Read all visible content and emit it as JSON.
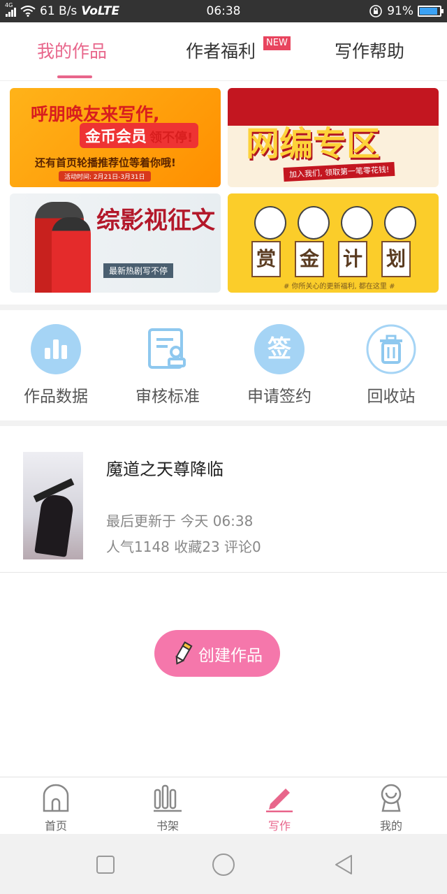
{
  "status_bar": {
    "network_type": "4G",
    "speed": "61 B/s",
    "volte": "VoLTE",
    "time": "06:38",
    "battery": "91%",
    "battery_level": 0.91,
    "battery_color": "#3ba2f5"
  },
  "tabs": [
    {
      "label": "我的作品",
      "active": true
    },
    {
      "label": "作者福利",
      "badge": "NEW"
    },
    {
      "label": "写作帮助"
    }
  ],
  "accent_color": "#e8668b",
  "banners": [
    {
      "line1": "呼朋唤友来写作,",
      "line2": "金币会员",
      "line2b": "领不停!",
      "line3": "还有首页轮播推荐位等着你哦!",
      "date": "活动时间: 2月21日-3月31日"
    },
    {
      "title": "网编专区",
      "subtitle": "加入我们, 领取第一笔零花钱!"
    },
    {
      "title": "综影视征文",
      "subtitle": "最新热剧写不停"
    },
    {
      "chars": [
        "赏",
        "金",
        "计",
        "划"
      ],
      "subtitle": "# 你所关心的更新福利, 都在这里 #"
    }
  ],
  "shortcuts": [
    {
      "label": "作品数据",
      "icon": "bar-chart-icon"
    },
    {
      "label": "审核标准",
      "icon": "document-stamp-icon"
    },
    {
      "label": "申请签约",
      "icon": "sign-icon",
      "icon_text": "签"
    },
    {
      "label": "回收站",
      "icon": "trash-icon"
    }
  ],
  "work": {
    "title": "魔道之天尊降临",
    "updated": "最后更新于 今天 06:38",
    "stats": "人气1148 收藏23 评论0"
  },
  "create_button": {
    "label": "创建作品",
    "color": "#f577ab"
  },
  "bottom_nav": [
    {
      "label": "首页",
      "icon": "home-icon"
    },
    {
      "label": "书架",
      "icon": "bookshelf-icon"
    },
    {
      "label": "写作",
      "icon": "pen-icon",
      "active": true
    },
    {
      "label": "我的",
      "icon": "profile-icon"
    }
  ]
}
